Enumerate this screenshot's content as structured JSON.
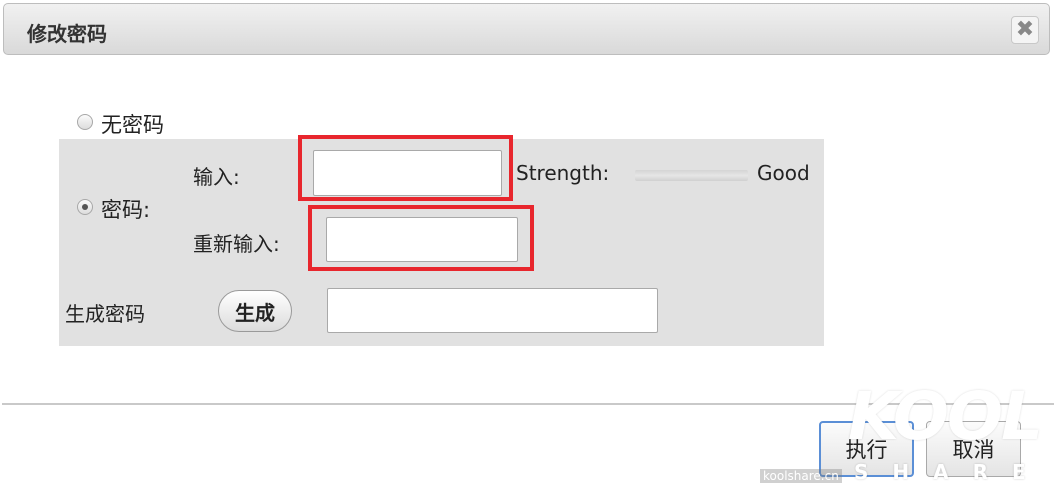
{
  "dialog": {
    "title": "修改密码",
    "close_glyph": "✖",
    "close_icon": "close-icon"
  },
  "options": {
    "no_password_label": "无密码",
    "password_label": "密码:",
    "selected": "password"
  },
  "fields": {
    "input_label": "输入:",
    "input_value": "",
    "reenter_label": "重新输入:",
    "reenter_value": "",
    "strength_label": "Strength:",
    "strength_value": "Good"
  },
  "generate": {
    "row_label": "生成密码",
    "button_label": "生成",
    "output_value": ""
  },
  "footer": {
    "apply_label": "执行",
    "cancel_label": "取消"
  },
  "watermark": {
    "brand": "KOOL",
    "sub": "SHARE",
    "site": "koolshare.cn"
  },
  "colors": {
    "highlight": "#e8262d",
    "panel": "#e1e1e1",
    "primary_border": "#5b8fd6"
  }
}
